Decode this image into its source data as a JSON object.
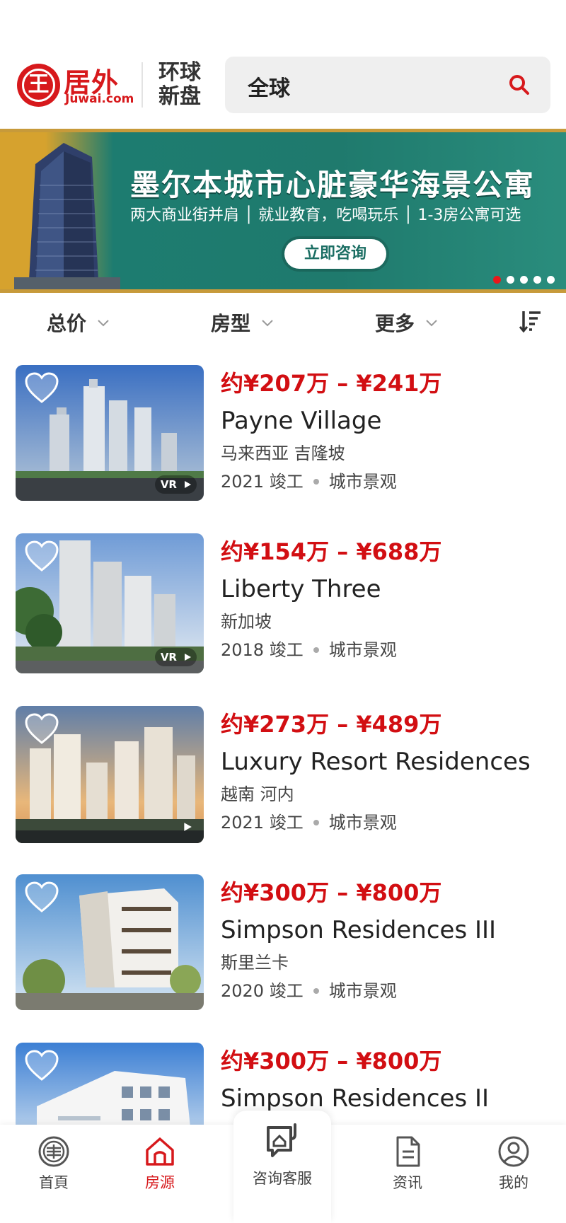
{
  "header": {
    "logo_cn": "居外",
    "logo_en": "Juwai.com",
    "tagline_line1": "环球",
    "tagline_line2": "新盘",
    "search_value": "全球"
  },
  "banner": {
    "title": "墨尔本城市心脏豪华海景公寓",
    "subtitle": "两大商业街并肩 │ 就业教育，吃喝玩乐 │ 1-3房公寓可选",
    "cta": "立即咨询",
    "slide_count": 5,
    "active_slide": 1
  },
  "filters": {
    "total_price": "总价",
    "layout": "房型",
    "more": "更多"
  },
  "listings": [
    {
      "price": "约¥207万 – ¥241万",
      "name": "Payne Village",
      "location": "马来西亚 吉隆坡",
      "completion": "2021 竣工",
      "view": "城市景观",
      "badge": "VR"
    },
    {
      "price": "约¥154万 – ¥688万",
      "name": "Liberty Three",
      "location": "新加坡",
      "completion": "2018 竣工",
      "view": "城市景观",
      "badge": "VR"
    },
    {
      "price": "约¥273万 – ¥489万",
      "name": "Luxury Resort Residences",
      "location": "越南 河内",
      "completion": "2021 竣工",
      "view": "城市景观",
      "badge": ""
    },
    {
      "price": "约¥300万 – ¥800万",
      "name": "Simpson Residences III",
      "location": "斯里兰卡",
      "completion": "2020 竣工",
      "view": "城市景观",
      "badge": ""
    },
    {
      "price": "约¥300万 – ¥800万",
      "name": "Simpson Residences II",
      "location": "",
      "completion": "",
      "view": "",
      "badge": ""
    }
  ],
  "bottom_nav": {
    "home": "首頁",
    "listings": "房源",
    "consult": "咨询客服",
    "news": "资讯",
    "me": "我的"
  },
  "colors": {
    "brand_red": "#d7191c",
    "price_red": "#d20e12",
    "banner_teal": "#1f7a6d",
    "banner_gold": "#d6a22e"
  }
}
